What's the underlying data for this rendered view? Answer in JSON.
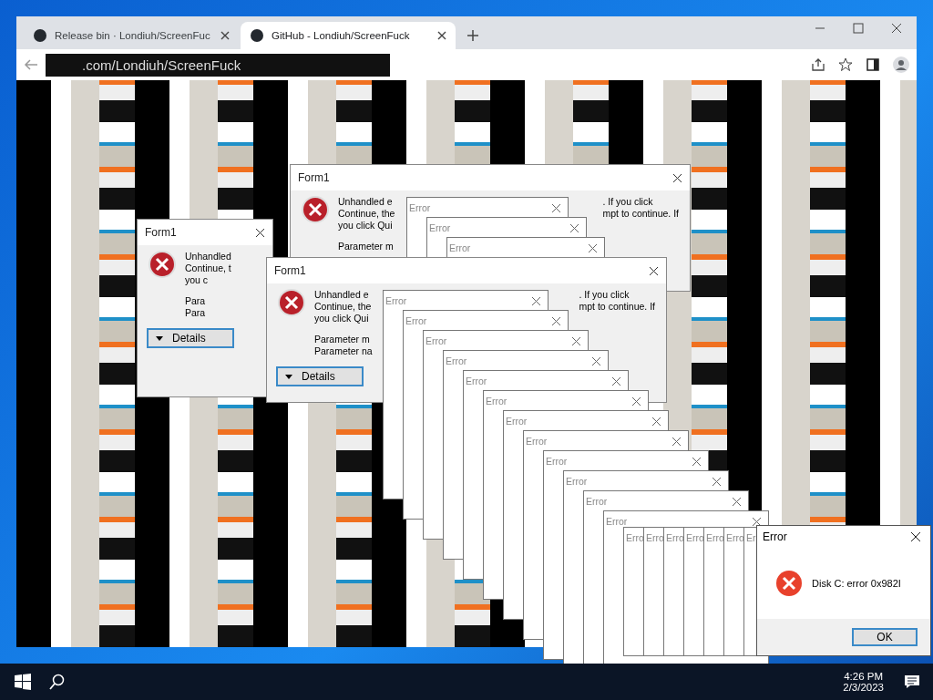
{
  "browser": {
    "tabs": [
      {
        "title": "Release bin · Londiuh/ScreenFuc",
        "selected": false
      },
      {
        "title": "GitHub - Londiuh/ScreenFuck",
        "selected": true
      }
    ],
    "address": ".com/Londiuh/ScreenFuck"
  },
  "form_dialogs": [
    {
      "title": "Form1",
      "message_left": [
        "Unhandled",
        "Continue, t",
        "you c"
      ],
      "parameters": [
        "Para",
        "Para"
      ],
      "button": "Details"
    },
    {
      "title": "Form1",
      "message_left": [
        "Unhandled e",
        "Continue, the",
        "you click Qui"
      ],
      "message_right": [
        ". If you click",
        "mpt to continue. If"
      ],
      "parameters": [
        "Parameter m"
      ]
    },
    {
      "title": "Form1",
      "message_left": [
        "Unhandled e",
        "Continue, the",
        "you click Qui"
      ],
      "message_right": [
        ". If you click",
        "mpt to continue. If"
      ],
      "parameters": [
        "Parameter m",
        "Parameter na"
      ],
      "button": "Details"
    }
  ],
  "top_errors": [
    {
      "title": "Error"
    },
    {
      "title": "Error"
    },
    {
      "title": "Error"
    }
  ],
  "error_cascade": [
    {
      "title": "Error"
    },
    {
      "title": "Error"
    },
    {
      "title": "Error"
    },
    {
      "title": "Error"
    },
    {
      "title": "Error"
    },
    {
      "title": "Error"
    },
    {
      "title": "Error"
    },
    {
      "title": "Error"
    },
    {
      "title": "Error"
    },
    {
      "title": "Error"
    },
    {
      "title": "Error"
    },
    {
      "title": "Error"
    }
  ],
  "error_strip": [
    {
      "title": "Erro"
    },
    {
      "title": "Erro"
    },
    {
      "title": "Erro"
    },
    {
      "title": "Erro"
    },
    {
      "title": "Erro"
    },
    {
      "title": "Erro"
    },
    {
      "title": "Er"
    }
  ],
  "disk_error": {
    "title": "Error",
    "message": "Disk C: error 0x982I",
    "button": "OK"
  },
  "taskbar": {
    "time": "4:26 PM",
    "date": "2/3/2023"
  }
}
